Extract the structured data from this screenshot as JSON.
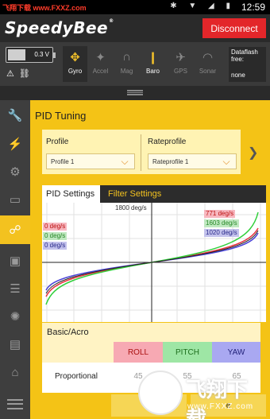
{
  "status_bar": {
    "watermark": "飞翔下载 www.FXXZ.com",
    "icons": "✱ ▼ ◢ ▮",
    "time": "12:59"
  },
  "header": {
    "logo": "SpeedyBee",
    "logo_mark": "®",
    "disconnect_label": "Disconnect"
  },
  "sensors": {
    "battery_value": "0.3 V",
    "warn_icon": "⚠",
    "plug_icon": "⛓",
    "items": [
      {
        "label": "Gyro",
        "active": true
      },
      {
        "label": "Accel",
        "active": false
      },
      {
        "label": "Mag",
        "active": false
      },
      {
        "label": "Baro",
        "active": true
      },
      {
        "label": "GPS",
        "active": false
      },
      {
        "label": "Sonar",
        "active": false
      }
    ],
    "dataflash_label": "Dataflash free:",
    "dataflash_value": "none"
  },
  "page": {
    "title": "PID Tuning",
    "profile_label": "Profile",
    "profile_value": "Profile 1",
    "rateprofile_label": "Rateprofile",
    "rateprofile_value": "Rateprofile 1"
  },
  "tabs": {
    "pid_settings": "PID Settings",
    "filter_settings": "Filter Settings"
  },
  "curve": {
    "top_label": "1800 deg/s",
    "left_roll": "0 deg/s",
    "left_pitch": "0 deg/s",
    "left_yaw": "0 deg/s",
    "right_roll": "771 deg/s",
    "right_pitch": "1603 deg/s",
    "right_yaw": "1020 deg/s",
    "colors": {
      "roll": "#e8323f",
      "pitch": "#2fcf3a",
      "yaw": "#4a43d6"
    }
  },
  "basic": {
    "title": "Basic/Acro",
    "col_roll": "ROLL",
    "col_pitch": "PITCH",
    "col_yaw": "YAW",
    "row_proportional": "Proportional",
    "p_roll": "45",
    "p_pitch": "55",
    "p_yaw": "65"
  },
  "buttons": {
    "reset": "Re",
    "save": "e"
  },
  "watermark": {
    "text": "飞翔下载",
    "sub": "www.FXXZ.com"
  }
}
